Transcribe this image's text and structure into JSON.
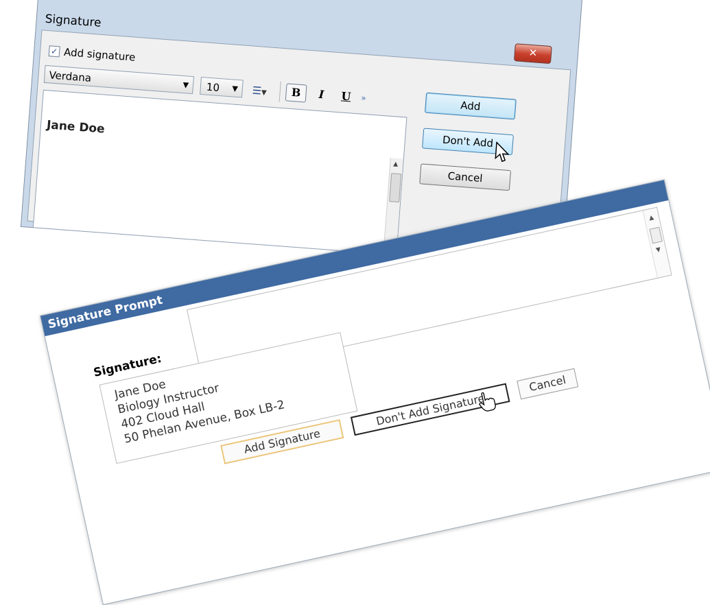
{
  "dialog1": {
    "title": "Signature",
    "close_glyph": "✕",
    "add_signature_checkbox": {
      "label": "Add signature",
      "checked": true
    },
    "font_select": {
      "value": "Verdana"
    },
    "size_select": {
      "value": "10"
    },
    "list_glyph": "☰",
    "format_bold": "B",
    "format_italic": "I",
    "format_underline": "U",
    "more_glyph": "»",
    "editor_text": "Jane Doe",
    "buttons": {
      "add": "Add",
      "dont_add": "Don't Add",
      "cancel": "Cancel"
    }
  },
  "dialog2": {
    "title": "Signature Prompt",
    "signature_label": "Signature:",
    "signature_lines": [
      "Jane Doe",
      "Biology Instructor",
      "402 Cloud Hall",
      "50 Phelan Avenue, Box LB-2"
    ],
    "buttons": {
      "add": "Add Signature",
      "dont_add": "Don't Add Signature",
      "cancel": "Cancel"
    }
  },
  "colors": {
    "title_bar_blue": "#3f6aa2",
    "close_red": "#c8402c",
    "add_highlight": "#e2b45c"
  }
}
